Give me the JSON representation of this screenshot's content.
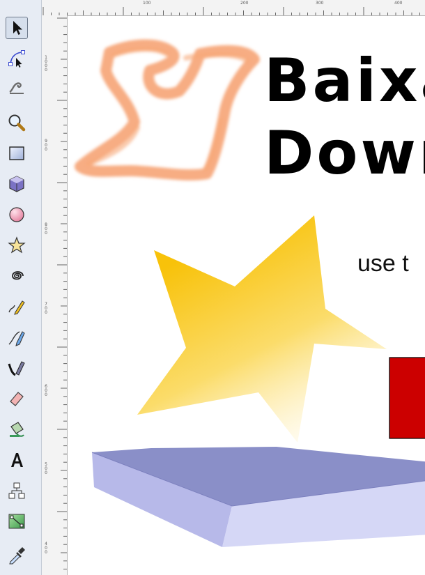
{
  "toolbox": {
    "tools": [
      {
        "id": "selector",
        "icon": "arrow-pointer-icon",
        "active": true
      },
      {
        "id": "node-editor",
        "icon": "node-edit-icon",
        "active": false
      },
      {
        "id": "tweak",
        "icon": "tweak-icon",
        "active": false
      },
      {
        "id": "zoom",
        "icon": "magnifier-icon",
        "active": false
      },
      {
        "id": "rectangle",
        "icon": "rectangle-icon",
        "active": false
      },
      {
        "id": "box-3d",
        "icon": "box-3d-icon",
        "active": false
      },
      {
        "id": "ellipse",
        "icon": "ellipse-icon",
        "active": false
      },
      {
        "id": "star",
        "icon": "star-icon",
        "active": false
      },
      {
        "id": "spiral",
        "icon": "spiral-icon",
        "active": false
      },
      {
        "id": "pencil",
        "icon": "pencil-icon",
        "active": false
      },
      {
        "id": "pen",
        "icon": "pen-icon",
        "active": false
      },
      {
        "id": "calligraphy",
        "icon": "calligraphy-icon",
        "active": false
      },
      {
        "id": "eraser",
        "icon": "eraser-icon",
        "active": false
      },
      {
        "id": "paint-bucket",
        "icon": "paint-bucket-icon",
        "active": false
      },
      {
        "id": "text",
        "icon": "text-icon",
        "active": false
      },
      {
        "id": "connector",
        "icon": "connector-icon",
        "active": false
      },
      {
        "id": "gradient",
        "icon": "gradient-icon",
        "active": false
      },
      {
        "id": "dropper",
        "icon": "dropper-icon",
        "active": false
      }
    ]
  },
  "rulers": {
    "horizontal_labels": [
      "100",
      "200",
      "300",
      "400"
    ],
    "vertical_labels": [
      "1000",
      "900",
      "800",
      "700",
      "600",
      "500",
      "400"
    ]
  },
  "canvas": {
    "title_line1": "Baixa",
    "title_line2": "Down",
    "subtitle": "use t",
    "colors": {
      "star_top": "#f8c20a",
      "star_bottom": "#fff4c8",
      "platform_top": "#8a8fc8",
      "platform_side": "#d5d7f6",
      "red_box": "#cc0000",
      "brush": "#f4915a"
    }
  }
}
